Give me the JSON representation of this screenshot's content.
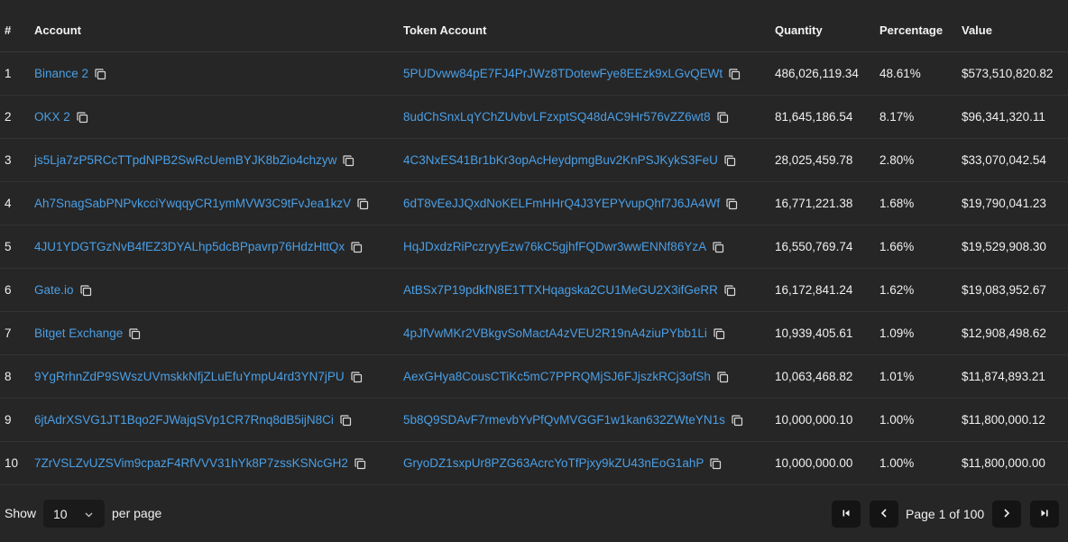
{
  "headers": {
    "num": "#",
    "account": "Account",
    "token_account": "Token Account",
    "quantity": "Quantity",
    "percentage": "Percentage",
    "value": "Value"
  },
  "rows": [
    {
      "num": "1",
      "account": "Binance 2",
      "token_account": "5PUDvww84pE7FJ4PrJWz8TDotewFye8EEzk9xLGvQEWt",
      "quantity": "486,026,119.34",
      "percentage": "48.61%",
      "value": "$573,510,820.82"
    },
    {
      "num": "2",
      "account": "OKX 2",
      "token_account": "8udChSnxLqYChZUvbvLFzxptSQ48dAC9Hr576vZZ6wt8",
      "quantity": "81,645,186.54",
      "percentage": "8.17%",
      "value": "$96,341,320.11"
    },
    {
      "num": "3",
      "account": "js5Lja7zP5RCcTTpdNPB2SwRcUemBYJK8bZio4chzyw",
      "token_account": "4C3NxES41Br1bKr3opAcHeydpmgBuv2KnPSJKykS3FeU",
      "quantity": "28,025,459.78",
      "percentage": "2.80%",
      "value": "$33,070,042.54"
    },
    {
      "num": "4",
      "account": "Ah7SnagSabPNPvkcciYwqqyCR1ymMVW3C9tFvJea1kzV",
      "token_account": "6dT8vEeJJQxdNoKELFmHHrQ4J3YEPYvupQhf7J6JA4Wf",
      "quantity": "16,771,221.38",
      "percentage": "1.68%",
      "value": "$19,790,041.23"
    },
    {
      "num": "5",
      "account": "4JU1YDGTGzNvB4fEZ3DYALhp5dcBPpavrp76HdzHttQx",
      "token_account": "HqJDxdzRiPczryyEzw76kC5gjhfFQDwr3wwENNf86YzA",
      "quantity": "16,550,769.74",
      "percentage": "1.66%",
      "value": "$19,529,908.30"
    },
    {
      "num": "6",
      "account": "Gate.io",
      "token_account": "AtBSx7P19pdkfN8E1TTXHqagska2CU1MeGU2X3ifGeRR",
      "quantity": "16,172,841.24",
      "percentage": "1.62%",
      "value": "$19,083,952.67"
    },
    {
      "num": "7",
      "account": "Bitget Exchange",
      "token_account": "4pJfVwMKr2VBkgvSoMactA4zVEU2R19nA4ziuPYbb1Li",
      "quantity": "10,939,405.61",
      "percentage": "1.09%",
      "value": "$12,908,498.62"
    },
    {
      "num": "8",
      "account": "9YgRrhnZdP9SWszUVmskkNfjZLuEfuYmpU4rd3YN7jPU",
      "token_account": "AexGHya8CousCTiKc5mC7PPRQMjSJ6FJjszkRCj3ofSh",
      "quantity": "10,063,468.82",
      "percentage": "1.01%",
      "value": "$11,874,893.21"
    },
    {
      "num": "9",
      "account": "6jtAdrXSVG1JT1Bqo2FJWajqSVp1CR7Rnq8dB5ijN8Ci",
      "token_account": "5b8Q9SDAvF7rmevbYvPfQvMVGGF1w1kan632ZWteYN1s",
      "quantity": "10,000,000.10",
      "percentage": "1.00%",
      "value": "$11,800,000.12"
    },
    {
      "num": "10",
      "account": "7ZrVSLZvUZSVim9cpazF4RfVVV31hYk8P7zssKSNcGH2",
      "token_account": "GryoDZ1sxpUr8PZG63AcrcYoTfPjxy9kZU43nEoG1ahP",
      "quantity": "10,000,000.00",
      "percentage": "1.00%",
      "value": "$11,800,000.00"
    }
  ],
  "footer": {
    "show_label": "Show",
    "per_page_value": "10",
    "per_page_label": "per page",
    "page_info": "Page 1 of 100"
  },
  "colors": {
    "background": "#262626",
    "link": "#4a9fe6",
    "text": "#f0f0f0",
    "row_border": "#333333",
    "button_bg": "#141414"
  },
  "icons": {
    "copy": "copy-icon",
    "select_chevron": "chevron-down-icon",
    "first_page": "first-page-icon",
    "prev_page": "chevron-left-icon",
    "next_page": "chevron-right-icon",
    "last_page": "last-page-icon"
  }
}
